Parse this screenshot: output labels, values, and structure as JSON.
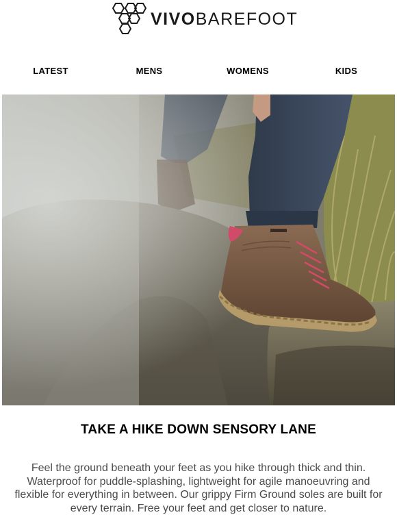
{
  "brand": {
    "name_bold": "VIVO",
    "name_light": "BAREFOOT"
  },
  "nav": {
    "items": [
      {
        "label": "LATEST"
      },
      {
        "label": "MENS"
      },
      {
        "label": "WOMENS"
      },
      {
        "label": "KIDS"
      }
    ]
  },
  "hero": {
    "icon": "hiker-boot-on-rock-photo"
  },
  "content": {
    "headline": "TAKE A HIKE DOWN SENSORY LANE",
    "body": "Feel the ground beneath your feet as you hike through thick and thin. Waterproof for puddle-splashing, lightweight for agile manoeuvring and flexible for everything in between. Our grippy Firm Ground soles are built for every terrain. Free your feet and get closer to nature."
  },
  "colors": {
    "text": "#000000",
    "body_text": "#4a4a4a",
    "boot_brown": "#7a5a43",
    "lace_pink": "#d24a6a"
  }
}
